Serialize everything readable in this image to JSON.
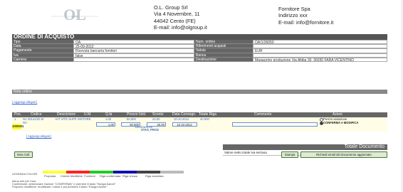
{
  "header": {
    "from_name": "O.L. Group Srl",
    "from_address": "Via 4 Novembre, 11",
    "from_city": "44042 Cento (FE)",
    "from_email": "E-mail: info@olgroup.it",
    "to_name": "Fornitore Spa",
    "to_address": "Indirizzo xxx",
    "to_email": "E-mail: info@fornitore.it"
  },
  "title": "ORDINE DI ACQUISTO",
  "info_left": [
    {
      "label": "Tipo",
      "value": "OA"
    },
    {
      "label": "Data",
      "value": "25-09-2012"
    },
    {
      "label": "Pagamento",
      "value": "Ricevuta bancaria fornitori"
    },
    {
      "label": "Iva",
      "value": "false"
    },
    {
      "label": "Carriera",
      "value": ""
    }
  ],
  "info_right": [
    {
      "label": "Num. ordine",
      "value": "OA/1/36050"
    },
    {
      "label": "Riferimenti acquisti",
      "value": ""
    },
    {
      "label": "Valuta",
      "value": "EUR"
    },
    {
      "label": "Banca",
      "value": ""
    },
    {
      "label": "Destinazione",
      "value": "Magazzino produzione Via Altiba 30, 36030 FARA VICENTINO"
    }
  ],
  "notes": {
    "bar_label": "Nota ordine",
    "add_link": "[ Aggiungi allegati ]"
  },
  "grid": {
    "headers": [
      "Pos.",
      "Codice",
      "Descrizione",
      "U.M.",
      "Q.tà",
      "Prezzo Unit.",
      "Sconto",
      "Data Consegn.",
      "Totale Riga",
      "Commento",
      "Azioni"
    ],
    "row": {
      "pos": "1",
      "codice": "NV 00141/20 M",
      "codice2": "NV",
      "descrizione": "KIT VITE SUPP. MOTORE",
      "qty": "1.00",
      "price": "50,000",
      "sconto": "20.00",
      "data": "10-10-2012",
      "totale": "40.000",
      "qty_input": "1,00",
      "price_input": "50,000",
      "sconto_input": "20.00",
      "data_input": "10-10-2012",
      "id": "1000001",
      "dest_label": "Destinazione : ",
      "dest_value": "STAS_PRCD",
      "action1": "Prezzo variazione",
      "action2": "CONFERMA e MODIFICA"
    },
    "add_link": "[ Aggiungi allegati ]"
  },
  "totals": {
    "bar_label": "Totale Documento",
    "row_label": "Valore netto totale iva esclusa",
    "row_value": "40 EUR"
  },
  "buttons": {
    "back": "Invia Coll.",
    "print": "Stampa",
    "email": "Richiedi email del documento aggiornato"
  },
  "legend": {
    "title": "LEGENDA COLORI",
    "items": [
      "Proposta",
      "Chiede Modifiche",
      "Fornitore",
      "Riga confermata",
      "Riga chiusa",
      "Riga annullata"
    ]
  },
  "footer": {
    "line1": "Istruz.ioni per l'uso:",
    "line2": "Confermare: selezionare l'azione \"CONFERMA\" e premere il tasto \"Esegui Azioni\"",
    "line3": "Proporre modifiche: modificare i valori e poi premere il tasto \"Esegui Azioni\""
  },
  "colors": {
    "legend": [
      "#ffff33",
      "#ff2222",
      "#22cc22",
      "#1111aa",
      "#444444",
      "#bbbbbb"
    ]
  }
}
